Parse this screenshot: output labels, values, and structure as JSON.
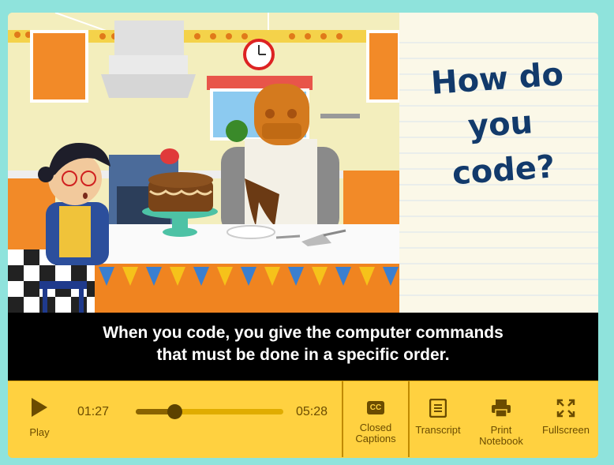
{
  "notebook": {
    "title": "How do\nyou code?"
  },
  "caption": {
    "line1": "When you code, you give the computer commands",
    "line2": "that must be done in a specific order."
  },
  "controls": {
    "play_label": "Play",
    "elapsed": "01:27",
    "duration": "05:28",
    "progress_fraction": 0.265,
    "cc_label_1": "Closed",
    "cc_label_2": "Captions",
    "transcript_label": "Transcript",
    "print_label_1": "Print",
    "print_label_2": "Notebook",
    "fullscreen_label": "Fullscreen"
  },
  "colors": {
    "controls_bg": "#ffd140",
    "icon": "#6b4c00",
    "page_bg": "#8fe3dc"
  }
}
